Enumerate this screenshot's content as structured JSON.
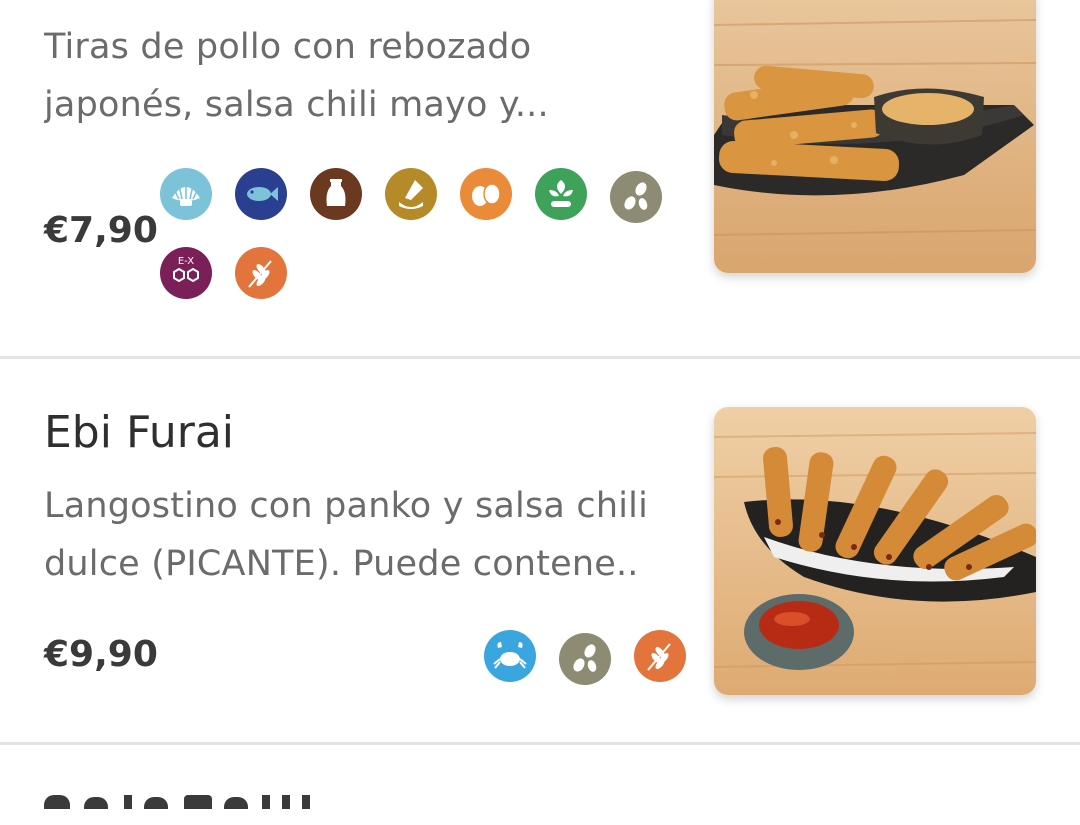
{
  "items": [
    {
      "description_line1": "Tiras de pollo con rebozado",
      "description_line2": "japonés, salsa chili mayo y...",
      "price": "€7,90",
      "allergens": [
        {
          "icon": "shellfish-icon",
          "color": "#7cc3da"
        },
        {
          "icon": "fish-icon",
          "color": "#2a3f8f"
        },
        {
          "icon": "milk-icon",
          "color": "#6b3920"
        },
        {
          "icon": "mustard-icon",
          "color": "#b58b2a"
        },
        {
          "icon": "egg-icon",
          "color": "#e98b38"
        },
        {
          "icon": "soy-icon",
          "color": "#3ea25b"
        },
        {
          "icon": "sesame-icon",
          "color": "#8d8b74"
        },
        {
          "icon": "sulphites-icon",
          "color": "#7a1f58"
        },
        {
          "icon": "gluten-icon",
          "color": "#e3743c"
        }
      ]
    },
    {
      "title": "Ebi Furai",
      "description_line1": "Langostino con panko y salsa chili",
      "description_line2": "dulce (PICANTE). Puede contene..",
      "price": "€9,90",
      "allergens": [
        {
          "icon": "crustacean-icon",
          "color": "#3aa6df"
        },
        {
          "icon": "sesame-icon",
          "color": "#8d8b74"
        },
        {
          "icon": "gluten-icon",
          "color": "#e3743c"
        }
      ]
    }
  ],
  "sulphites_label": "E-X"
}
